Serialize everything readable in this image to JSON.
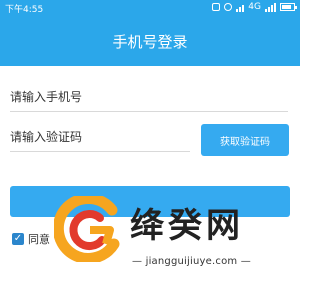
{
  "statusbar": {
    "time": "下午4:55",
    "network": "4G"
  },
  "header": {
    "title": "手机号登录"
  },
  "form": {
    "phone_placeholder": "请输入手机号",
    "code_placeholder": "请输入验证码",
    "get_code_label": "获取验证码",
    "agree_text": "同意"
  },
  "watermark": {
    "title": "绛癸网",
    "url": "jiangguijiuye.com"
  },
  "colors": {
    "primary": "#2ba7ea",
    "button": "#35aaf0",
    "checkbox": "#2b86cc"
  }
}
